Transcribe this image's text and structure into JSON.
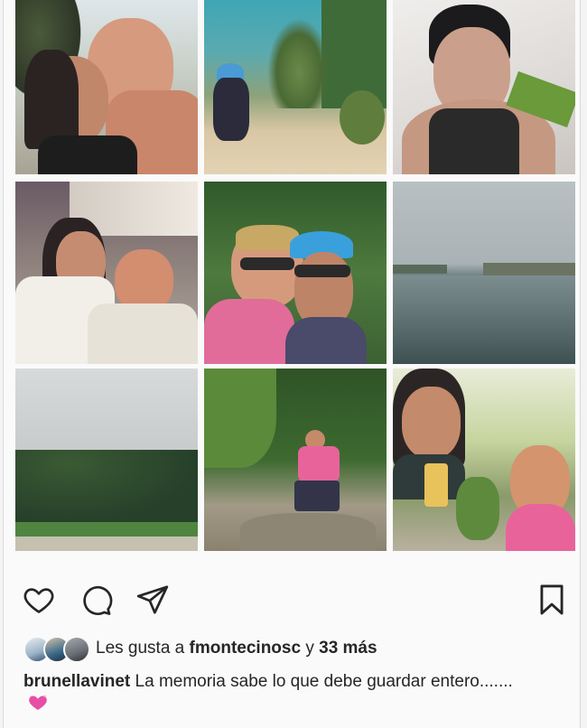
{
  "post": {
    "photos": [
      {
        "name": "photo-couple-palms",
        "alt": "Couple selfie under palm trees"
      },
      {
        "name": "photo-garden-crouching",
        "alt": "Woman crouching in garden"
      },
      {
        "name": "photo-woman-selfie",
        "alt": "Woman selfie"
      },
      {
        "name": "photo-couple-indoors",
        "alt": "Couple indoors"
      },
      {
        "name": "photo-couple-sunglasses",
        "alt": "Couple with sunglasses in jungle"
      },
      {
        "name": "photo-lake",
        "alt": "Calm lake landscape"
      },
      {
        "name": "photo-garden-lawn",
        "alt": "Lawn and trees under cloudy sky"
      },
      {
        "name": "photo-man-jungle",
        "alt": "Man posing on jungle path"
      },
      {
        "name": "photo-couple-drinks",
        "alt": "Couple with drinks"
      }
    ],
    "actions": {
      "like_icon": "heart-outline-icon",
      "comment_icon": "comment-icon",
      "share_icon": "paper-plane-icon",
      "save_icon": "bookmark-icon"
    },
    "likes": {
      "prefix": "Les gusta a ",
      "user": "fmontecinosc",
      "middle": " y ",
      "count": "33 más"
    },
    "caption": {
      "user": "brunellavinet",
      "text": " La memoria sabe lo que debe guardar entero.......",
      "emoji": "sparkling-heart"
    }
  },
  "colors": {
    "text": "#262626",
    "background": "#fafafa",
    "emoji_pink": "#e64fa3"
  }
}
